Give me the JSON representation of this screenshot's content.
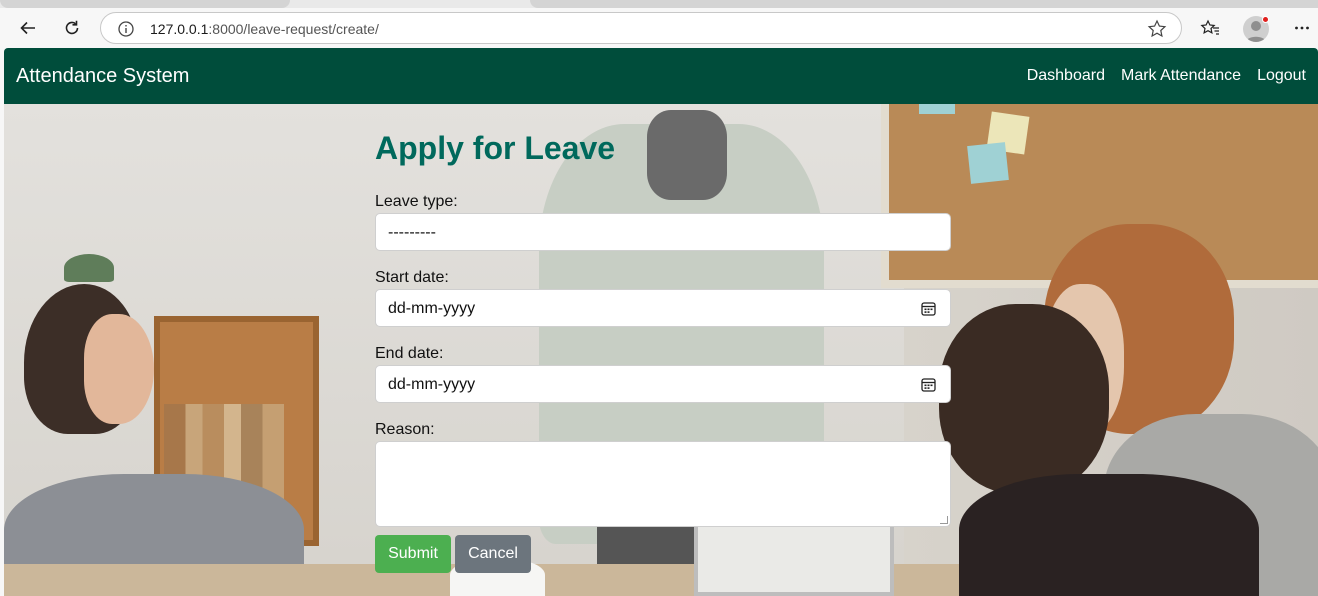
{
  "browser": {
    "url_host": "127.0.0.1",
    "url_rest": ":8000/leave-request/create/"
  },
  "navbar": {
    "brand": "Attendance System",
    "links": [
      {
        "label": "Dashboard"
      },
      {
        "label": "Mark Attendance"
      },
      {
        "label": "Logout"
      }
    ]
  },
  "form": {
    "title": "Apply for Leave",
    "leave_type": {
      "label": "Leave type:",
      "value": "---------"
    },
    "start_date": {
      "label": "Start date:",
      "placeholder": "dd-mm-yyyy"
    },
    "end_date": {
      "label": "End date:",
      "placeholder": "dd-mm-yyyy"
    },
    "reason": {
      "label": "Reason:",
      "value": ""
    },
    "submit_label": "Submit",
    "cancel_label": "Cancel"
  },
  "colors": {
    "navbar_bg": "#004d3b",
    "title": "#00695c",
    "submit_bg": "#4caf50",
    "cancel_bg": "#6c757d"
  },
  "icons": [
    "back-arrow-icon",
    "reload-icon",
    "info-icon",
    "star-icon",
    "favorites-icon",
    "profile-icon",
    "more-icon",
    "calendar-icon"
  ]
}
